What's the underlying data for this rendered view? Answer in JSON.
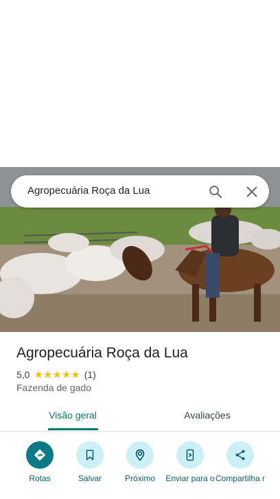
{
  "search": {
    "query": "Agropecuária Roça da Lua"
  },
  "place": {
    "name": "Agropecuária Roça da Lua",
    "rating": "5,0",
    "review_count": "(1)",
    "stars": "★★★★★",
    "category": "Fazenda de gado"
  },
  "tabs": [
    {
      "label": "Visão geral",
      "active": true
    },
    {
      "label": "Avaliações",
      "active": false
    }
  ],
  "actions": [
    {
      "label": "Rotas",
      "icon": "directions-icon"
    },
    {
      "label": "Salvar",
      "icon": "bookmark-icon"
    },
    {
      "label": "Próximo",
      "icon": "nearby-icon"
    },
    {
      "label": "Enviar para o",
      "icon": "send-to-phone-icon"
    },
    {
      "label": "Compartilha r",
      "icon": "share-icon"
    }
  ],
  "colors": {
    "accent": "#00796b",
    "action_bg": "#cdeff6",
    "primary_action": "#0b7a86",
    "star": "#fbbc04"
  }
}
